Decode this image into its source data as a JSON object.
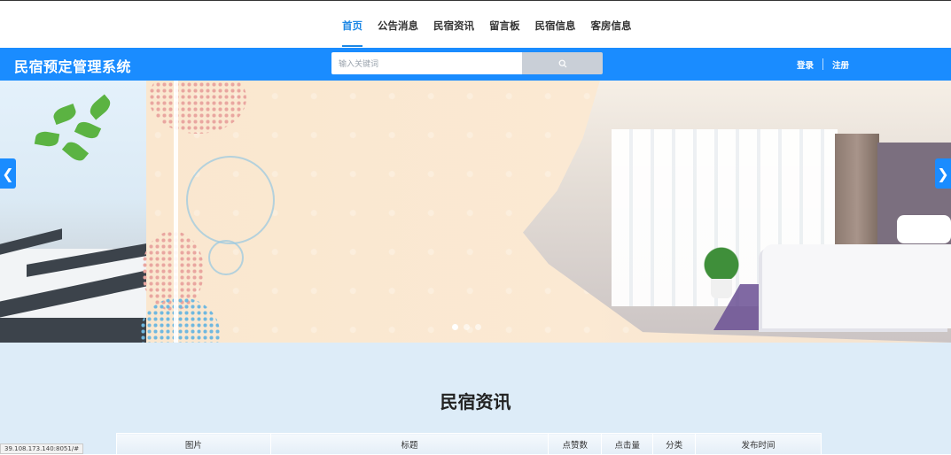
{
  "nav": {
    "items": [
      {
        "label": "首页",
        "active": true
      },
      {
        "label": "公告消息",
        "active": false
      },
      {
        "label": "民宿资讯",
        "active": false
      },
      {
        "label": "留言板",
        "active": false
      },
      {
        "label": "民宿信息",
        "active": false
      },
      {
        "label": "客房信息",
        "active": false
      }
    ]
  },
  "header": {
    "brand": "民宿预定管理系统",
    "search_placeholder": "输入关键词",
    "search_icon": "search-icon",
    "login_label": "登录",
    "register_label": "注册"
  },
  "carousel": {
    "prev_icon": "chevron-left-icon",
    "next_icon": "chevron-right-icon",
    "prev_glyph": "❮",
    "next_glyph": "❯",
    "slide_count": 3,
    "active_index": 0
  },
  "section": {
    "title": "民宿资讯",
    "table_headers": [
      "图片",
      "标题",
      "点赞数",
      "点击量",
      "分类",
      "发布时间"
    ]
  },
  "status_bar": {
    "url": "39.108.173.140:8051/#"
  },
  "colors": {
    "accent": "#1a8cff",
    "active_nav": "#1e88e5",
    "content_bg": "#ddecf8"
  }
}
